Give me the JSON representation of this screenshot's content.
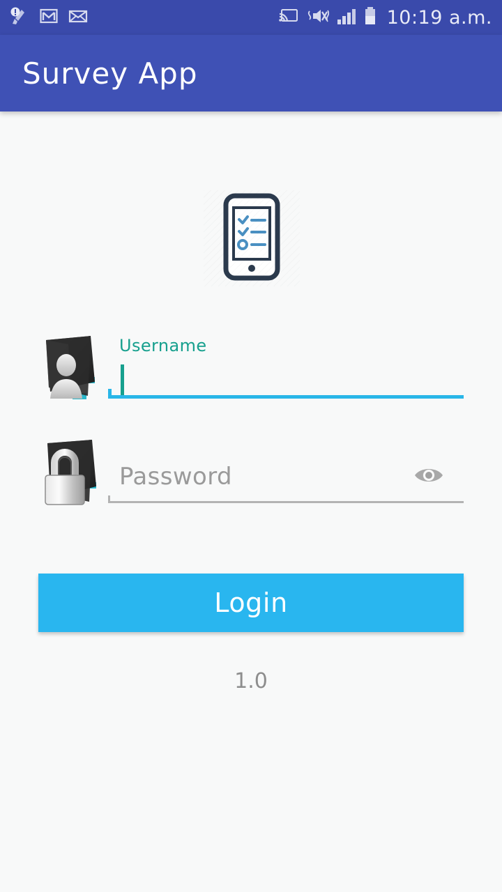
{
  "status_bar": {
    "background_color": "#3a4aab",
    "time": "10:19 a.m.",
    "left_icons": [
      {
        "name": "cleaner-alert-icon",
        "label": "Cleaner alert"
      },
      {
        "name": "gmail-icon",
        "label": "Gmail"
      },
      {
        "name": "mail-envelope-icon",
        "label": "Email"
      }
    ],
    "right_icons": [
      {
        "name": "cast-icon",
        "label": "Screen cast"
      },
      {
        "name": "vibrate-mute-icon",
        "label": "Sound off / vibrate"
      },
      {
        "name": "signal-bars-icon",
        "label": "Cellular signal"
      },
      {
        "name": "battery-icon",
        "label": "Battery"
      }
    ]
  },
  "app_bar": {
    "title": "Survey App",
    "background_color": "#3f51b5",
    "title_color": "#ffffff"
  },
  "logo": {
    "name": "survey-checklist-phone-logo",
    "alt": "Smartphone with checklist",
    "outline_color": "#2b3a4d",
    "accent_color": "#4a90c2"
  },
  "form": {
    "username": {
      "label": "Username",
      "value": "",
      "placeholder": "Username",
      "focused": true,
      "label_color": "#17a08e",
      "underline_color": "#29b6e8",
      "icon_name": "user-folder-icon"
    },
    "password": {
      "label": "Password",
      "value": "",
      "placeholder": "Password",
      "focused": false,
      "placeholder_color": "#9a9a9a",
      "underline_color": "#b3b3b3",
      "icon_name": "lock-folder-icon",
      "visibility_toggle": {
        "name": "eye-icon",
        "label": "Show password",
        "color": "#a8a8a8"
      }
    }
  },
  "login_button": {
    "label": "Login",
    "background_color": "#29b6ef",
    "text_color": "#ffffff"
  },
  "version": {
    "text": "1.0",
    "color": "#8d8d8d"
  },
  "page": {
    "background_color": "#f8f9f9"
  }
}
